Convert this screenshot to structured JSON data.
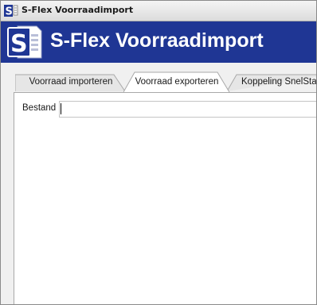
{
  "window": {
    "title": "S-Flex Voorraadimport",
    "title_icon": "s-app-icon"
  },
  "banner": {
    "title": "S-Flex Voorraadimport",
    "logo": "s-document-logo-icon",
    "background_color": "#1f3694"
  },
  "tabs": [
    {
      "label": "Voorraad importeren",
      "selected": false
    },
    {
      "label": "Voorraad exporteren",
      "selected": true
    },
    {
      "label": "Koppeling SnelStart",
      "selected": false
    }
  ],
  "export_tab": {
    "file_label": "Bestand",
    "file_value": ""
  }
}
